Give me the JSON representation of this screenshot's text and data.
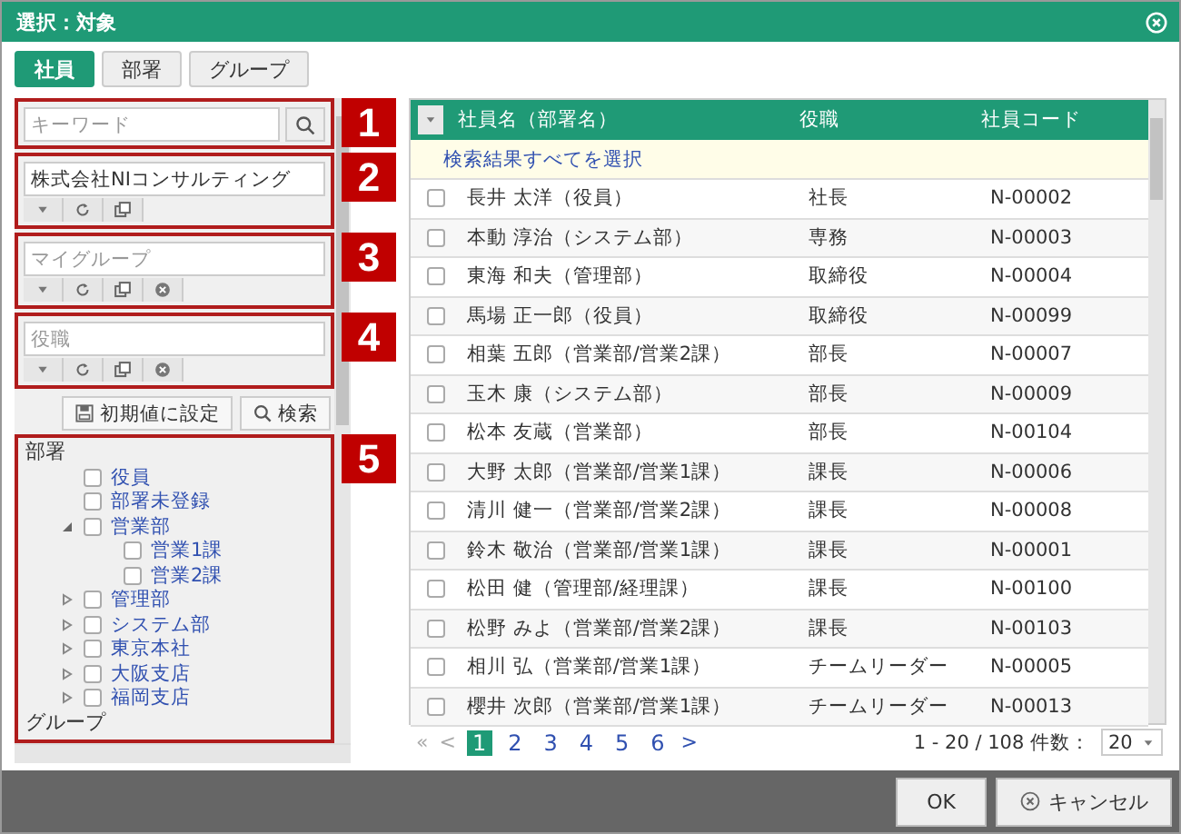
{
  "window": {
    "title": "選択：対象"
  },
  "tabs": [
    {
      "label": "社員",
      "selected": true
    },
    {
      "label": "部署",
      "selected": false
    },
    {
      "label": "グループ",
      "selected": false
    }
  ],
  "filters": [
    {
      "kind": "search",
      "placeholder": "キーワード",
      "callout": "1"
    },
    {
      "kind": "picker",
      "value": "株式会社NIコンサルティング",
      "clearable": false,
      "callout": "2"
    },
    {
      "kind": "picker",
      "placeholder": "マイグループ",
      "clearable": true,
      "callout": "3"
    },
    {
      "kind": "picker",
      "placeholder": "役職",
      "clearable": true,
      "callout": "4"
    }
  ],
  "filter_buttons": [
    {
      "kind": "save",
      "label": "初期値に設定"
    },
    {
      "kind": "search",
      "label": "検索"
    }
  ],
  "tree": {
    "callout": "5",
    "sections": [
      {
        "label": "部署",
        "items": [
          {
            "label": "役員",
            "checked": false
          },
          {
            "label": "部署未登録",
            "checked": false
          },
          {
            "label": "営業部",
            "checked": false,
            "expanded": true,
            "children": [
              {
                "label": "営業1課",
                "checked": false
              },
              {
                "label": "営業2課",
                "checked": false
              }
            ]
          },
          {
            "label": "管理部",
            "checked": false,
            "expanded": false
          },
          {
            "label": "システム部",
            "checked": false,
            "expanded": false
          },
          {
            "label": "東京本社",
            "checked": false,
            "expanded": false
          },
          {
            "label": "大阪支店",
            "checked": false,
            "expanded": false
          },
          {
            "label": "福岡支店",
            "checked": false,
            "expanded": false
          }
        ]
      },
      {
        "label": "グループ"
      }
    ]
  },
  "table": {
    "columns": [
      "社員名（部署名）",
      "役職",
      "社員コード"
    ],
    "select_all": "検索結果すべてを選択",
    "rows": [
      {
        "name": "長井 太洋（役員）",
        "title": "社長",
        "code": "N-00002",
        "checked": false
      },
      {
        "name": "本動 淳治（システム部）",
        "title": "専務",
        "code": "N-00003",
        "checked": false
      },
      {
        "name": "東海 和夫（管理部）",
        "title": "取締役",
        "code": "N-00004",
        "checked": false
      },
      {
        "name": "馬場 正一郎（役員）",
        "title": "取締役",
        "code": "N-00099",
        "checked": false
      },
      {
        "name": "相葉 五郎（営業部/営業2課）",
        "title": "部長",
        "code": "N-00007",
        "checked": false
      },
      {
        "name": "玉木 康（システム部）",
        "title": "部長",
        "code": "N-00009",
        "checked": false
      },
      {
        "name": "松本 友蔵（営業部）",
        "title": "部長",
        "code": "N-00104",
        "checked": false
      },
      {
        "name": "大野 太郎（営業部/営業1課）",
        "title": "課長",
        "code": "N-00006",
        "checked": false
      },
      {
        "name": "清川 健一（営業部/営業2課）",
        "title": "課長",
        "code": "N-00008",
        "checked": false
      },
      {
        "name": "鈴木 敬治（営業部/営業1課）",
        "title": "課長",
        "code": "N-00001",
        "checked": false
      },
      {
        "name": "松田 健（管理部/経理課）",
        "title": "課長",
        "code": "N-00100",
        "checked": false
      },
      {
        "name": "松野 みよ（営業部/営業2課）",
        "title": "課長",
        "code": "N-00103",
        "checked": false
      },
      {
        "name": "相川 弘（営業部/営業1課）",
        "title": "チームリーダー",
        "code": "N-00005",
        "checked": false
      },
      {
        "name": "櫻井 次郎（営業部/営業1課）",
        "title": "チームリーダー",
        "code": "N-00013",
        "checked": false
      }
    ]
  },
  "pagination": {
    "first": "«",
    "prev": "<",
    "pages": [
      {
        "label": "1",
        "selected": true
      },
      {
        "label": "2",
        "selected": false
      },
      {
        "label": "3",
        "selected": false
      },
      {
        "label": "4",
        "selected": false
      },
      {
        "label": "5",
        "selected": false
      },
      {
        "label": "6",
        "selected": false
      }
    ],
    "next": ">",
    "summary": "1 - 20 / 108 件数：",
    "page_size": "20"
  },
  "footer_buttons": [
    {
      "kind": "ok",
      "label": "OK"
    },
    {
      "kind": "cancel",
      "label": "キャンセル"
    }
  ]
}
